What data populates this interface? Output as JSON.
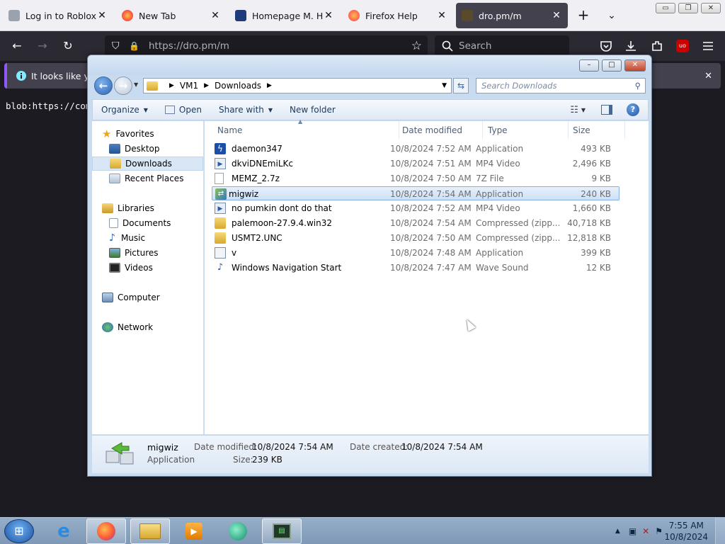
{
  "firefox": {
    "tabs": [
      {
        "title": "Log in to Roblox",
        "close": "✕"
      },
      {
        "title": "New Tab",
        "close": "✕"
      },
      {
        "title": "Homepage M. Hoe",
        "close": "✕"
      },
      {
        "title": "Firefox Help",
        "close": "✕"
      },
      {
        "title": "dro.pm/m",
        "close": "✕"
      }
    ],
    "new_tab": "+",
    "list_tabs": "⌄",
    "url": "https://dro.pm/m",
    "search_placeholder": "Search",
    "notice_text": "It looks like you",
    "notice_close": "✕",
    "content_text": "blob:https://comp",
    "win_minimize": "▭",
    "win_restore": "❐",
    "win_close": "✕",
    "nav": {
      "back": "←",
      "forward": "→",
      "reload": "↻",
      "shield": "⛉",
      "lock": "🔒",
      "star": "☆"
    }
  },
  "explorer": {
    "caption_buttons": {
      "minimize": "–",
      "maximize": "□",
      "close": "✕"
    },
    "breadcrumb": [
      "VM1",
      "Downloads"
    ],
    "search_placeholder": "Search Downloads",
    "toolbar": {
      "organize": "Organize",
      "open": "Open",
      "share_with": "Share with",
      "new_folder": "New folder"
    },
    "nav_pane": {
      "favorites": "Favorites",
      "desktop": "Desktop",
      "downloads": "Downloads",
      "recent_places": "Recent Places",
      "libraries": "Libraries",
      "documents": "Documents",
      "music": "Music",
      "pictures": "Pictures",
      "videos": "Videos",
      "computer": "Computer",
      "network": "Network"
    },
    "columns": {
      "name": "Name",
      "date_modified": "Date modified",
      "type": "Type",
      "size": "Size"
    },
    "files": [
      {
        "name": "daemon347",
        "date": "10/8/2024 7:52 AM",
        "type": "Application",
        "size": "493 KB",
        "icon": "app-icon"
      },
      {
        "name": "dkviDNEmiLKc",
        "date": "10/8/2024 7:51 AM",
        "type": "MP4 Video",
        "size": "2,496 KB",
        "icon": "video-file-icon"
      },
      {
        "name": "MEMZ_2.7z",
        "date": "10/8/2024 7:50 AM",
        "type": "7Z File",
        "size": "9 KB",
        "icon": "blank-file-icon"
      },
      {
        "name": "migwiz",
        "date": "10/8/2024 7:54 AM",
        "type": "Application",
        "size": "240 KB",
        "icon": "migwiz-icon"
      },
      {
        "name": "no pumkin dont do that",
        "date": "10/8/2024 7:52 AM",
        "type": "MP4 Video",
        "size": "1,660 KB",
        "icon": "video-file-icon"
      },
      {
        "name": "palemoon-27.9.4.win32",
        "date": "10/8/2024 7:54 AM",
        "type": "Compressed (zipp...",
        "size": "40,718 KB",
        "icon": "zip-folder-icon"
      },
      {
        "name": "USMT2.UNC",
        "date": "10/8/2024 7:50 AM",
        "type": "Compressed (zipp...",
        "size": "12,818 KB",
        "icon": "zip-folder-icon"
      },
      {
        "name": "v",
        "date": "10/8/2024 7:48 AM",
        "type": "Application",
        "size": "399 KB",
        "icon": "app-icon"
      },
      {
        "name": "Windows Navigation Start",
        "date": "10/8/2024 7:47 AM",
        "type": "Wave Sound",
        "size": "12 KB",
        "icon": "sound-file-icon"
      }
    ],
    "details": {
      "name": "migwiz",
      "type": "Application",
      "date_modified_label": "Date modified:",
      "date_modified": "10/8/2024 7:54 AM",
      "date_created_label": "Date created:",
      "date_created": "10/8/2024 7:54 AM",
      "size_label": "Size:",
      "size": "239 KB"
    }
  },
  "taskbar": {
    "time": "7:55 AM",
    "date": "10/8/2024"
  },
  "colors": {
    "firefox_dark": "#1c1b22",
    "selection": "#cde0f6",
    "accent": "#9059ff"
  }
}
